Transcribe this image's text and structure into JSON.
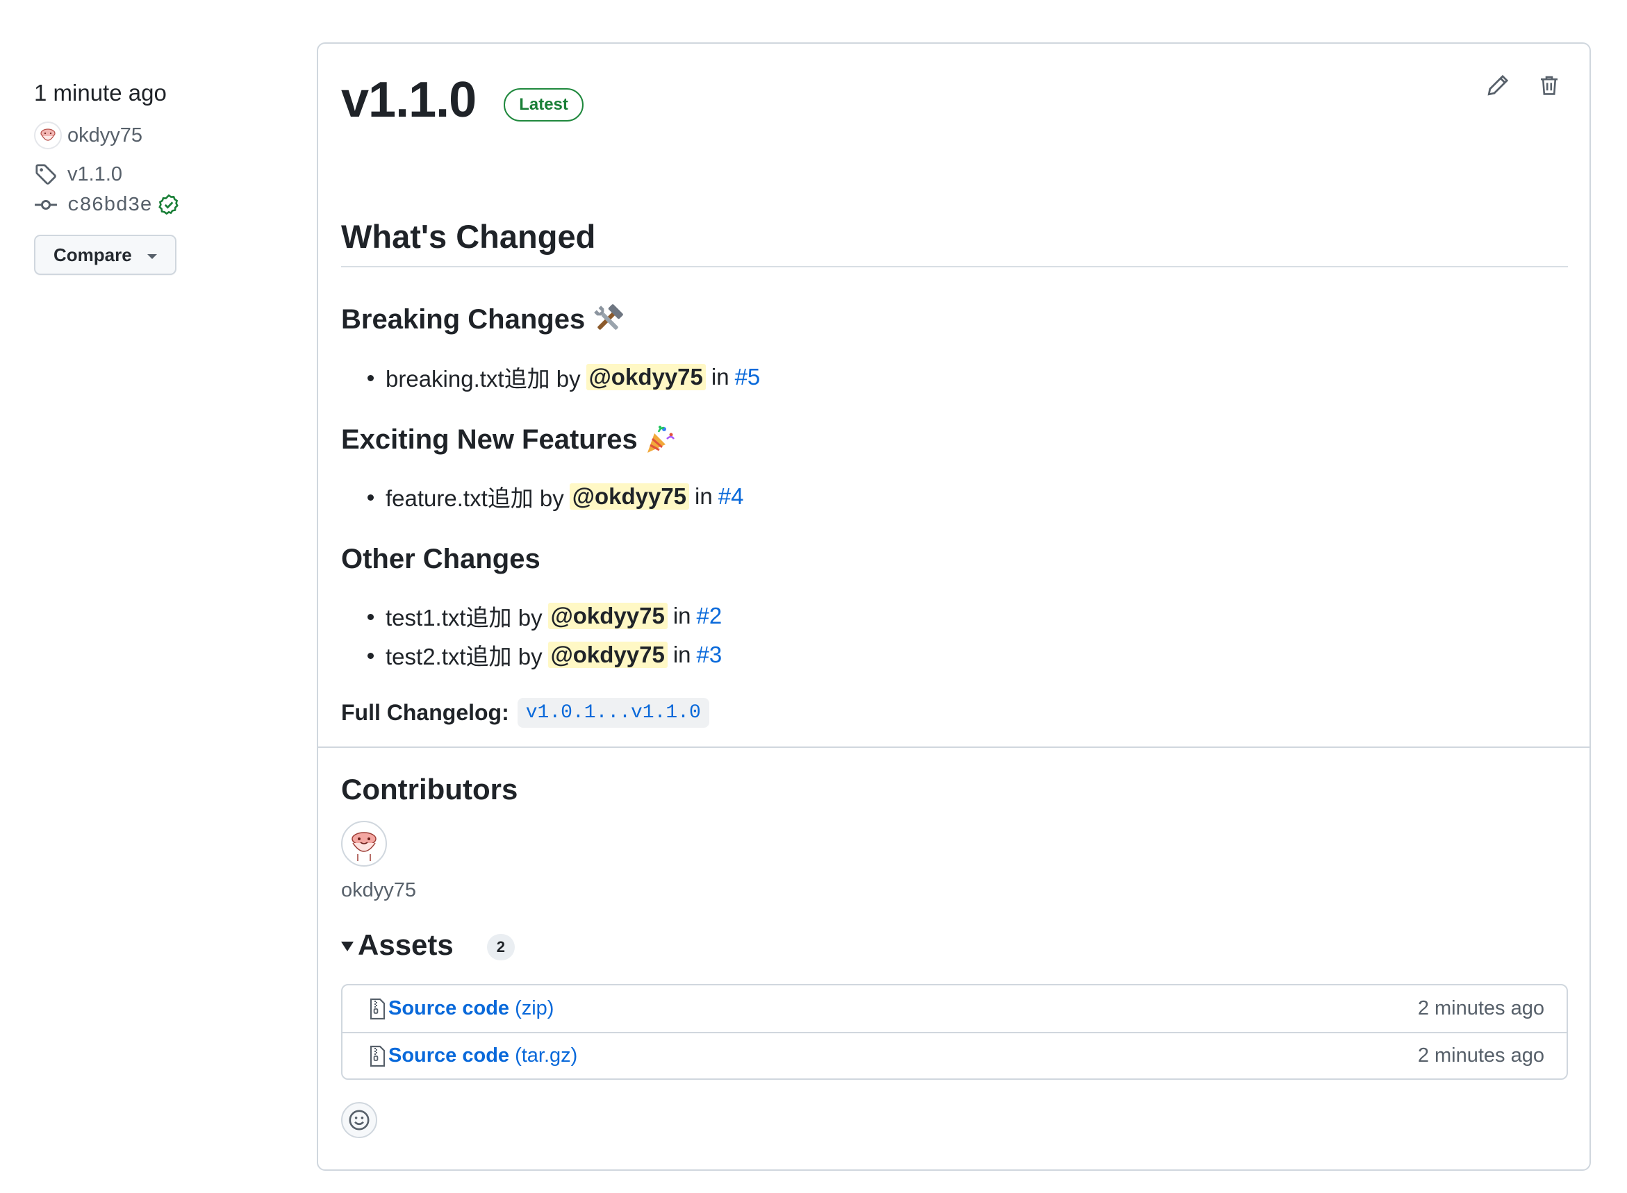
{
  "sidebar": {
    "time": "1 minute ago",
    "author": "okdyy75",
    "tag": "v1.1.0",
    "commit": "c86bd3e",
    "compare_label": "Compare"
  },
  "release": {
    "title": "v1.1.0",
    "badge": "Latest",
    "heading": "What's Changed",
    "sections": [
      {
        "title": "Breaking Changes",
        "emoji": "hammer-and-wrench",
        "items": [
          {
            "text": "breaking.txt追加 by",
            "mention": "@okdyy75",
            "in": "in",
            "issue": "#5"
          }
        ]
      },
      {
        "title": "Exciting New Features",
        "emoji": "party-popper",
        "items": [
          {
            "text": "feature.txt追加 by",
            "mention": "@okdyy75",
            "in": "in",
            "issue": "#4"
          }
        ]
      },
      {
        "title": "Other Changes",
        "emoji": "",
        "items": [
          {
            "text": "test1.txt追加 by",
            "mention": "@okdyy75",
            "in": "in",
            "issue": "#2"
          },
          {
            "text": "test2.txt追加 by",
            "mention": "@okdyy75",
            "in": "in",
            "issue": "#3"
          }
        ]
      }
    ],
    "full_changelog_label": "Full Changelog:",
    "full_changelog_link": "v1.0.1...v1.1.0"
  },
  "contributors": {
    "title": "Contributors",
    "names": [
      "okdyy75"
    ]
  },
  "assets": {
    "title": "Assets",
    "count": "2",
    "items": [
      {
        "name": "Source code",
        "kind": "(zip)",
        "time": "2 minutes ago"
      },
      {
        "name": "Source code",
        "kind": "(tar.gz)",
        "time": "2 minutes ago"
      }
    ]
  },
  "colors": {
    "link": "#0969da",
    "latest_green": "#1a7f37",
    "verified_green": "#1a7f37",
    "mention_bg": "#fff8c5",
    "border": "#d0d7de"
  }
}
